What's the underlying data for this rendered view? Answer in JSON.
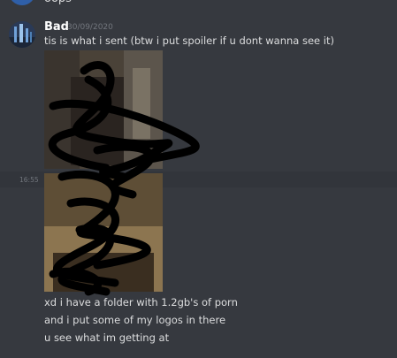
{
  "previous_message": {
    "text": "oops"
  },
  "message": {
    "username": "Bad",
    "timestamp": "30/09/2020",
    "lines": [
      "tis is what i sent (btw i put spoiler if u dont wanna see it)",
      "xd i have a folder with 1.2gb's of porn",
      "and i put some of my logos in there",
      "u see what im getting at"
    ],
    "hover_time": "16:55"
  },
  "colors": {
    "background": "#36393f",
    "username": "#ffffff",
    "text": "#dcddde",
    "muted": "#72767d"
  },
  "icons": {
    "avatar": "user-avatar-icon"
  }
}
